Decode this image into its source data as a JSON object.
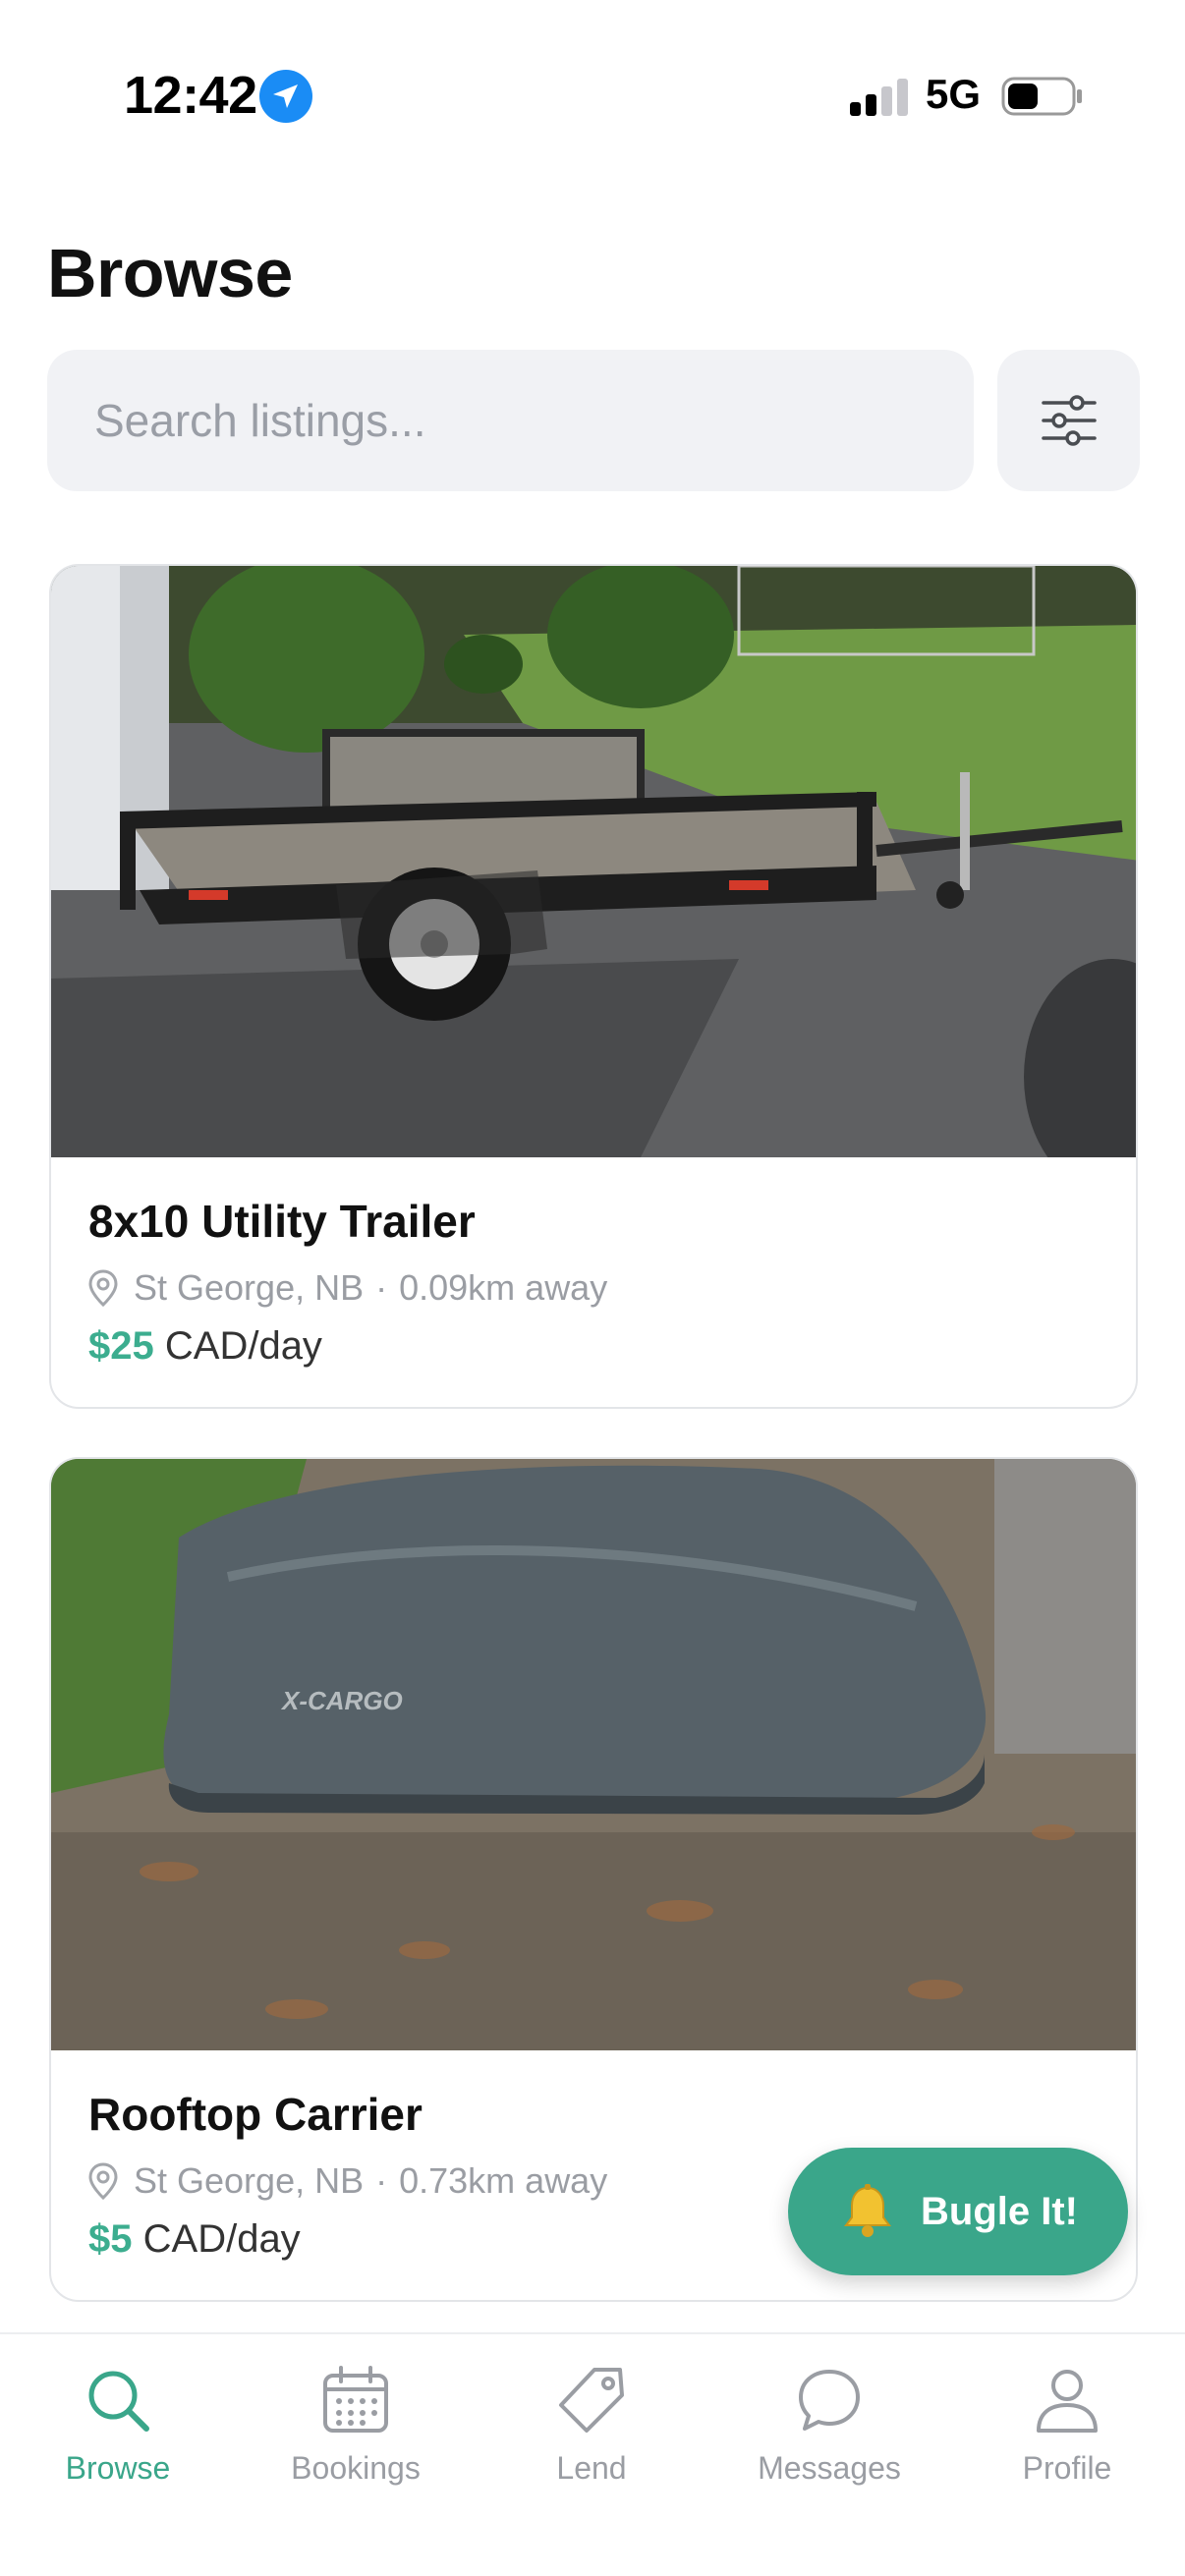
{
  "status_bar": {
    "time": "12:42",
    "network": "5G",
    "icons": [
      "location-arrow-icon",
      "signal-icon",
      "battery-icon"
    ]
  },
  "header": {
    "title": "Browse"
  },
  "search": {
    "placeholder": "Search listings...",
    "value": ""
  },
  "filter": {
    "icon": "sliders-icon"
  },
  "listings": [
    {
      "title": "8x10 Utility Trailer",
      "location": "St George, NB",
      "distance": "0.09km away",
      "separator": "·",
      "price": "$25",
      "unit": "CAD/day"
    },
    {
      "title": "Rooftop Carrier",
      "location": "St George, NB",
      "distance": "0.73km away",
      "separator": "·",
      "price": "$5",
      "unit": "CAD/day"
    }
  ],
  "fab": {
    "label": "Bugle It!",
    "icon": "bell-icon"
  },
  "nav": {
    "items": [
      {
        "label": "Browse",
        "icon": "search-icon",
        "active": true
      },
      {
        "label": "Bookings",
        "icon": "calendar-icon",
        "active": false
      },
      {
        "label": "Lend",
        "icon": "tag-icon",
        "active": false
      },
      {
        "label": "Messages",
        "icon": "chat-bubble-icon",
        "active": false
      },
      {
        "label": "Profile",
        "icon": "person-icon",
        "active": false
      }
    ]
  },
  "colors": {
    "accent": "#3aa68a",
    "price": "#3cad8f",
    "muted": "#9a9da3",
    "search_bg": "#f1f2f5"
  }
}
